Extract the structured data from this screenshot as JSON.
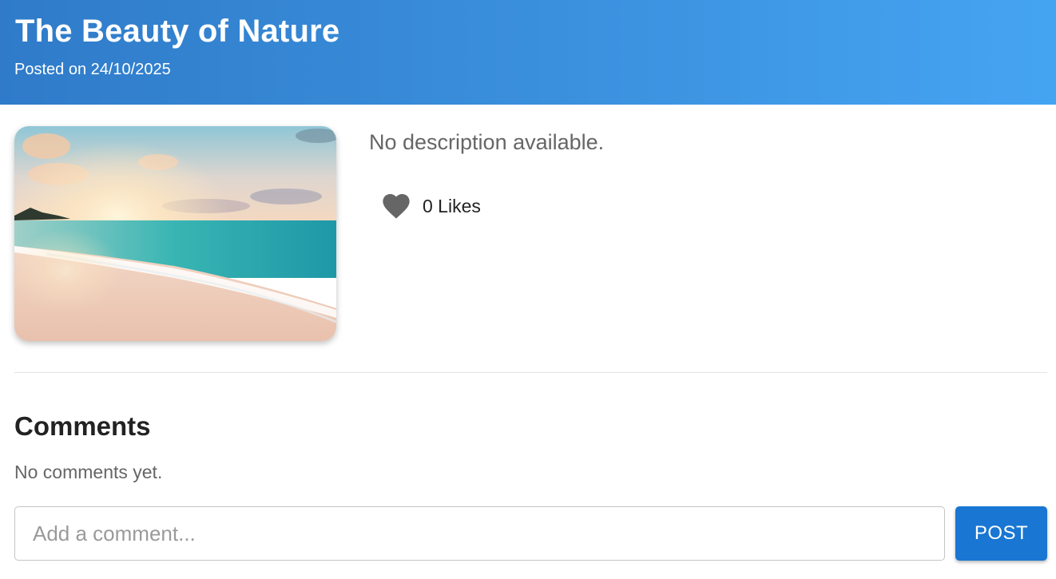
{
  "post": {
    "title": "The Beauty of Nature",
    "date": "Posted on 24/10/2025",
    "image_description": "beach-sunset-photo",
    "description": "No description available.",
    "likes_label": "0 Likes",
    "like_icon": "heart-icon"
  },
  "comments": {
    "heading": "Comments",
    "empty_text": "No comments yet.",
    "input_placeholder": "Add a comment...",
    "input_value": "",
    "post_button_label": "POST"
  },
  "colors": {
    "header_gradient_start": "#2f7bc9",
    "header_gradient_end": "#45a4f2",
    "button": "#1976d2",
    "heart": "#666666"
  }
}
